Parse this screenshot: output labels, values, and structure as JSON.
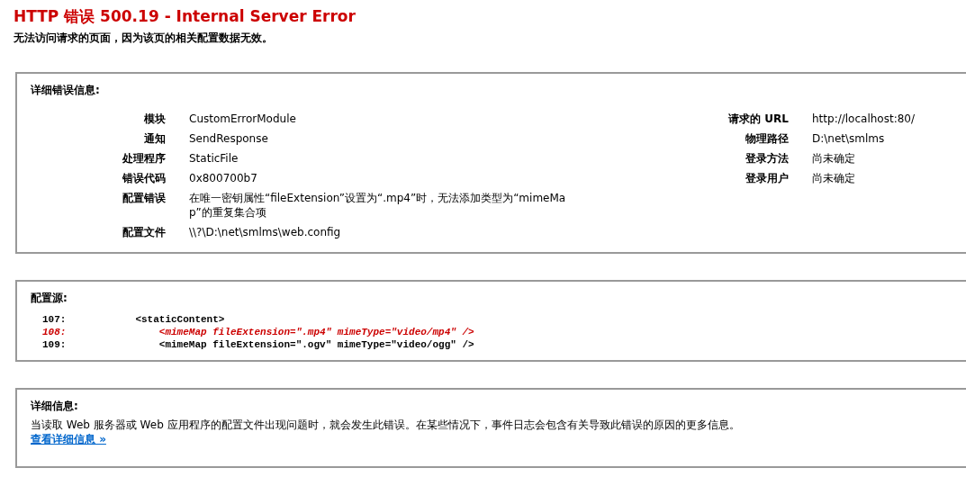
{
  "title": "HTTP 错误 500.19 - Internal Server Error",
  "subtitle": "无法访问请求的页面，因为该页的相关配置数据无效。",
  "error_details": {
    "heading": "详细错误信息:",
    "left": [
      {
        "label": "模块",
        "value": "CustomErrorModule"
      },
      {
        "label": "通知",
        "value": "SendResponse"
      },
      {
        "label": "处理程序",
        "value": "StaticFile"
      },
      {
        "label": "错误代码",
        "value": "0x800700b7"
      },
      {
        "label": "配置错误",
        "value": "在唯一密钥属性“fileExtension”设置为“.mp4”时，无法添加类型为“mimeMap”的重复集合项"
      },
      {
        "label": "配置文件",
        "value": "\\\\?\\D:\\net\\smlms\\web.config"
      }
    ],
    "right": [
      {
        "label": "请求的 URL",
        "value": "http://localhost:80/"
      },
      {
        "label": "物理路径",
        "value": "D:\\net\\smlms"
      },
      {
        "label": "登录方法",
        "value": "尚未确定"
      },
      {
        "label": "登录用户",
        "value": "尚未确定"
      }
    ]
  },
  "config_source": {
    "heading": "配置源:",
    "lines": [
      {
        "number": "107:",
        "code": "    <staticContent>",
        "highlighted": false
      },
      {
        "number": "108:",
        "code": "        <mimeMap fileExtension=\".mp4\" mimeType=\"video/mp4\" />",
        "highlighted": true
      },
      {
        "number": "109:",
        "code": "        <mimeMap fileExtension=\".ogv\" mimeType=\"video/ogg\" />",
        "highlighted": false
      }
    ]
  },
  "more_info": {
    "heading": "详细信息:",
    "text": "当读取 Web 服务器或 Web 应用程序的配置文件出现问题时，就会发生此错误。在某些情况下，事件日志会包含有关导致此错误的原因的更多信息。",
    "link": "查看详细信息 »"
  }
}
